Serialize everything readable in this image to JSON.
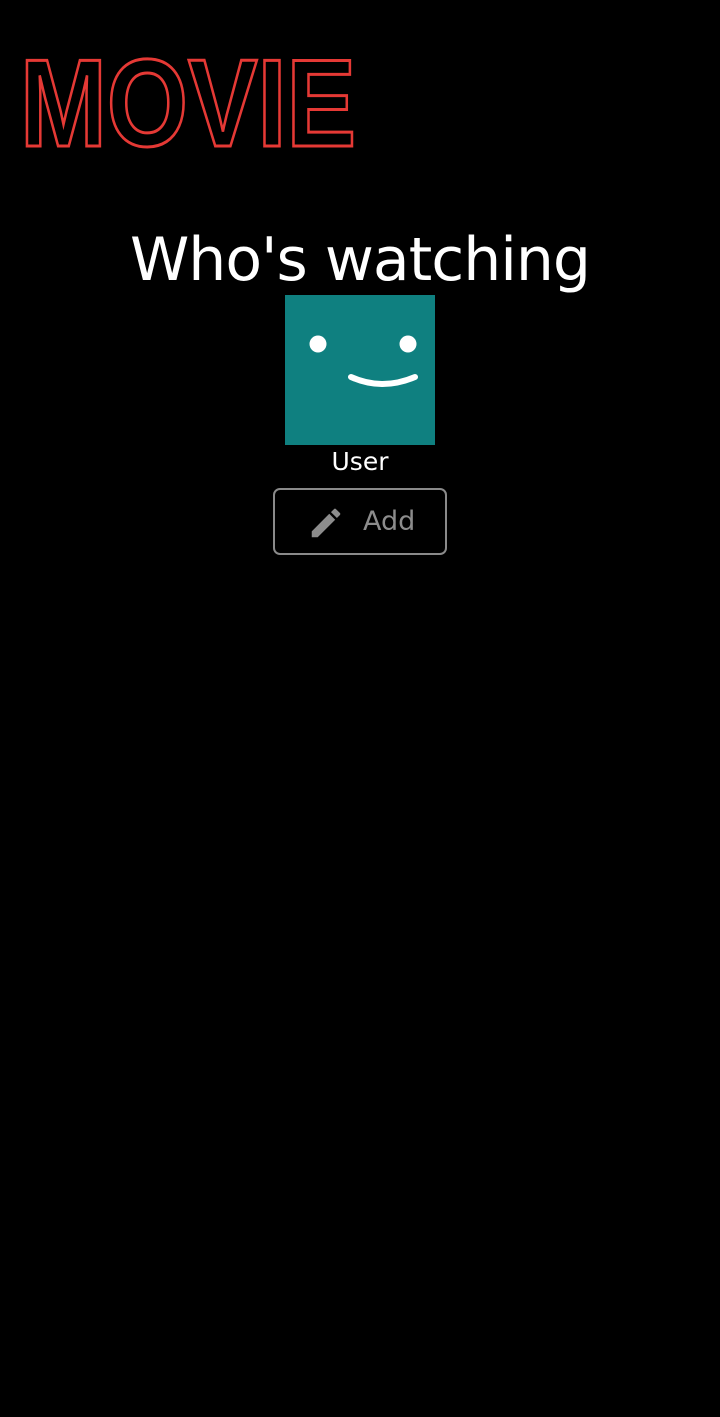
{
  "app": {
    "logo_text": "MOVIE",
    "logo_color": "#e53935"
  },
  "main": {
    "heading": "Who's watching",
    "profiles": [
      {
        "name": "User",
        "avatar_icon": "smiley-icon",
        "avatar_color": "#0f8080"
      }
    ],
    "add_button": {
      "label": "Add",
      "icon": "pencil-icon",
      "border_color": "#8a8a8a"
    }
  }
}
